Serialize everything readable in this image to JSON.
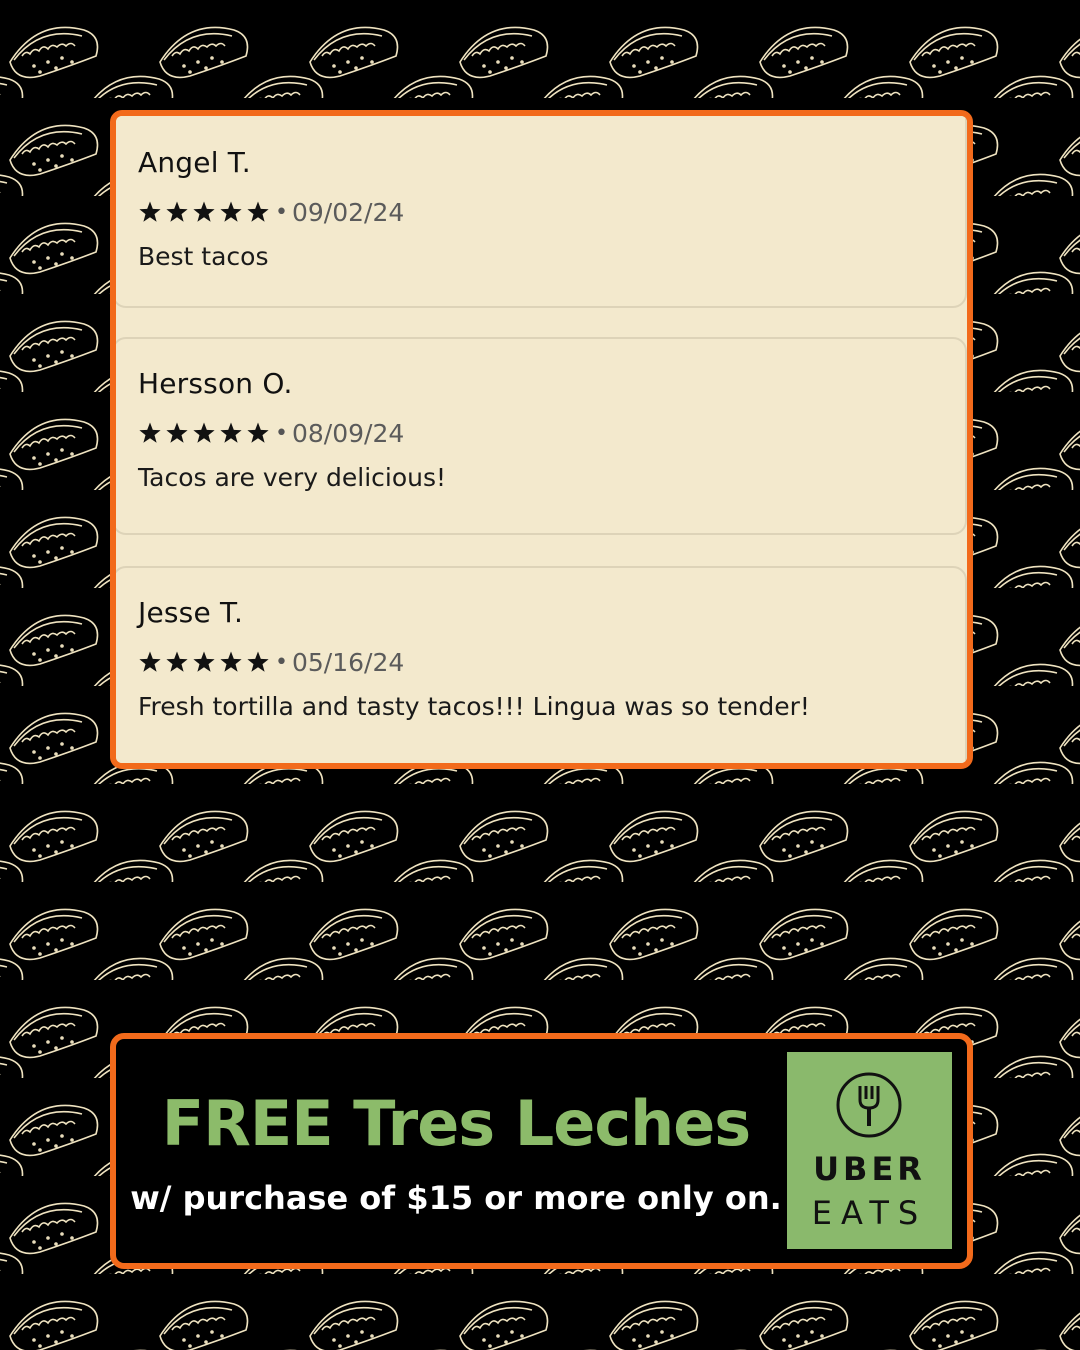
{
  "reviews": [
    {
      "name": "Angel T.",
      "rating": 5,
      "date": "09/02/24",
      "text": "Best tacos"
    },
    {
      "name": "Hersson O.",
      "rating": 5,
      "date": "08/09/24",
      "text": "Tacos are very delicious!"
    },
    {
      "name": "Jesse T.",
      "rating": 5,
      "date": "05/16/24",
      "text": "Fresh tortilla and tasty tacos!!! Lingua was so tender!"
    }
  ],
  "separator": "•",
  "promo": {
    "headline": "FREE Tres Leches",
    "subline": "w/ purchase of $15 or more only on."
  },
  "logo": {
    "brand_word_1": "UBER",
    "brand_word_2": "EATS",
    "icon": "fork-in-circle-icon",
    "color": "#8ab96c"
  },
  "colors": {
    "background": "#000000",
    "pattern": "#efe3c0",
    "panel": "#f3e9cd",
    "accent_border": "#f26a1b",
    "headline": "#8cbb6a"
  }
}
